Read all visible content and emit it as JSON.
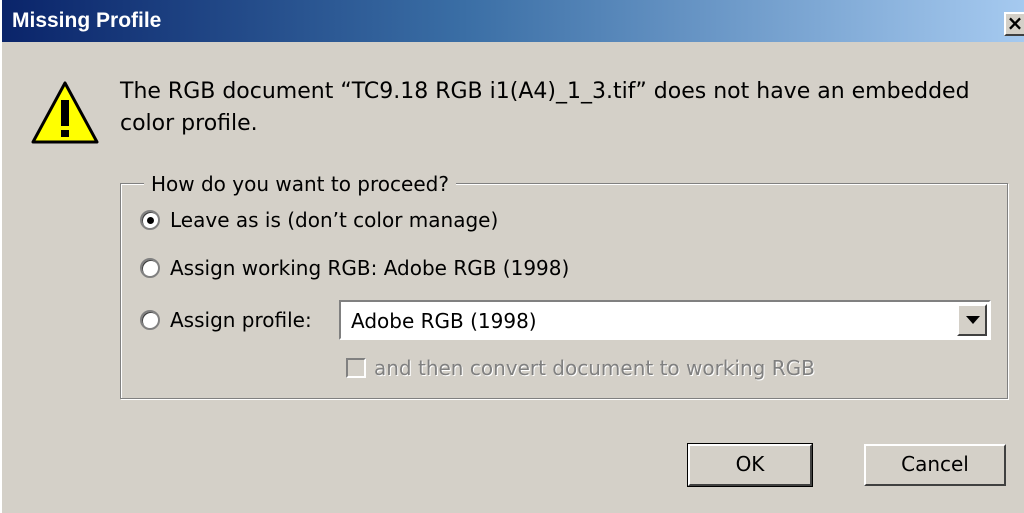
{
  "window": {
    "title": "Missing Profile",
    "close_glyph": "×"
  },
  "icons": {
    "warning": "warning-icon",
    "close": "close-icon",
    "dropdown": "chevron-down-icon"
  },
  "message": {
    "text": "The RGB document “TC9.18 RGB i1(A4)_1_3.tif” does not have an embedded color profile."
  },
  "options": {
    "legend": "How do you want to proceed?",
    "leave_label": "Leave as is (don’t color manage)",
    "assign_working_label": "Assign working RGB:  Adobe RGB (1998)",
    "assign_profile_label": "Assign profile:",
    "selected": "leave",
    "profile_select": {
      "value": "Adobe RGB (1998)"
    },
    "convert_checkbox": {
      "label": "and then convert document to working RGB",
      "checked": false,
      "disabled": true
    }
  },
  "buttons": {
    "ok": "OK",
    "cancel": "Cancel"
  },
  "colors": {
    "dialog_bg": "#d4d0c8",
    "title_start": "#0a246a",
    "title_end": "#a6caf0",
    "warning_fill": "#ffff00"
  }
}
